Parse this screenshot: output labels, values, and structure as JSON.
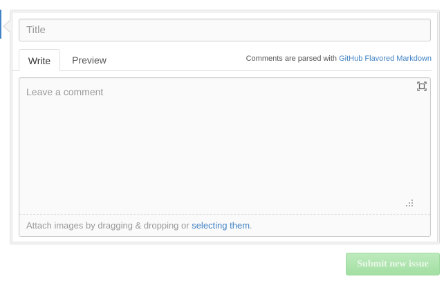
{
  "form": {
    "title_placeholder": "Title",
    "title_value": ""
  },
  "tabs": [
    {
      "label": "Write",
      "active": true
    },
    {
      "label": "Preview",
      "active": false
    }
  ],
  "markdown_note": {
    "prefix": "Comments are parsed with ",
    "link_label": "GitHub Flavored Markdown"
  },
  "comment": {
    "placeholder": "Leave a comment",
    "value": ""
  },
  "attach": {
    "prefix": "Attach images by dragging & dropping or ",
    "link_label": "selecting them",
    "suffix": "."
  },
  "submit_label": "Submit new issue",
  "icons": {
    "fullscreen": "fullscreen-icon",
    "resize": "resize-grip-icon"
  },
  "colors": {
    "link": "#4183c4",
    "submit_bg": "#a9e2a9",
    "accent_marker": "#4183c4"
  }
}
